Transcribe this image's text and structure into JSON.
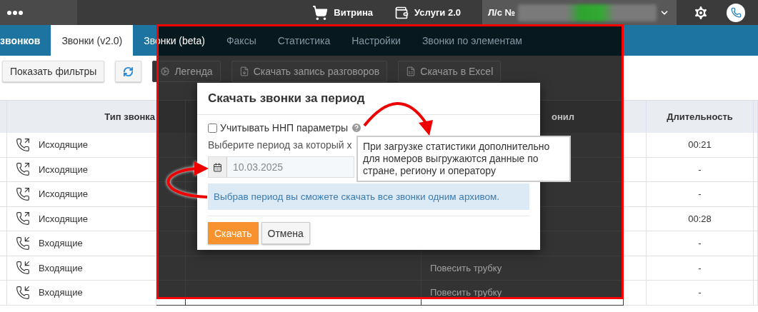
{
  "top_bar": {
    "links": [
      {
        "kind": "cart",
        "label": "Витрина"
      },
      {
        "kind": "services",
        "label": "Услуги 2.0"
      }
    ],
    "account": {
      "label": "Л/с №"
    }
  },
  "tabs": [
    {
      "label": "звонков",
      "selected": false
    },
    {
      "label": "Звонки (v2.0)",
      "selected": true
    },
    {
      "label": "Звонки (beta)",
      "selected": false
    },
    {
      "label": "Факсы",
      "selected": false
    },
    {
      "label": "Статистика",
      "selected": false
    },
    {
      "label": "Настройки",
      "selected": false
    },
    {
      "label": "Звонки по элементам",
      "selected": false
    }
  ],
  "toolbar": [
    {
      "kind": "text",
      "label": "Показать фильтры"
    },
    {
      "kind": "refresh"
    },
    {
      "kind": "legend",
      "label": "Легенда"
    },
    {
      "kind": "file",
      "label": "Скачать запись разговоров"
    },
    {
      "kind": "excel",
      "label": "Скачать в Excel"
    }
  ],
  "table": {
    "columns": [
      {
        "label": "Тип звонка"
      },
      {
        "label": "онил"
      },
      {
        "label": "Длительность"
      }
    ],
    "rows": [
      {
        "kind": "outgoing",
        "type": "Исходящие",
        "duration": "00:21"
      },
      {
        "kind": "outgoing",
        "type": "Исходящие",
        "duration": "-"
      },
      {
        "kind": "outgoing",
        "type": "Исходящие",
        "duration": "-"
      },
      {
        "kind": "outgoing",
        "type": "Исходящие",
        "duration": "00:28"
      },
      {
        "kind": "incoming",
        "type": "Входящие",
        "duration": "-"
      },
      {
        "kind": "incoming",
        "type": "Входящие",
        "column_4": "Повесить трубку",
        "duration": "-"
      },
      {
        "kind": "incoming",
        "type": "Входящие",
        "column_4": "Повесить трубку",
        "duration": "-"
      }
    ]
  },
  "dialog": {
    "title": "Скачать звонки за период",
    "checkbox": {
      "label": "Учитывать ННП параметры",
      "checked": false
    },
    "period_label": "Выберите период за который х",
    "date_field": {
      "value": "10.03.2025"
    },
    "info": "Выбрав период вы сможете скачать все звонки одним архивом.",
    "buttons": [
      {
        "kind": "primary",
        "label": "Скачать"
      },
      {
        "kind": "default",
        "label": "Отмена"
      }
    ]
  },
  "tooltip": {
    "text": "При загрузке статистики дополнительно для номеров выгружаются данные по стране, региону и оператору"
  }
}
